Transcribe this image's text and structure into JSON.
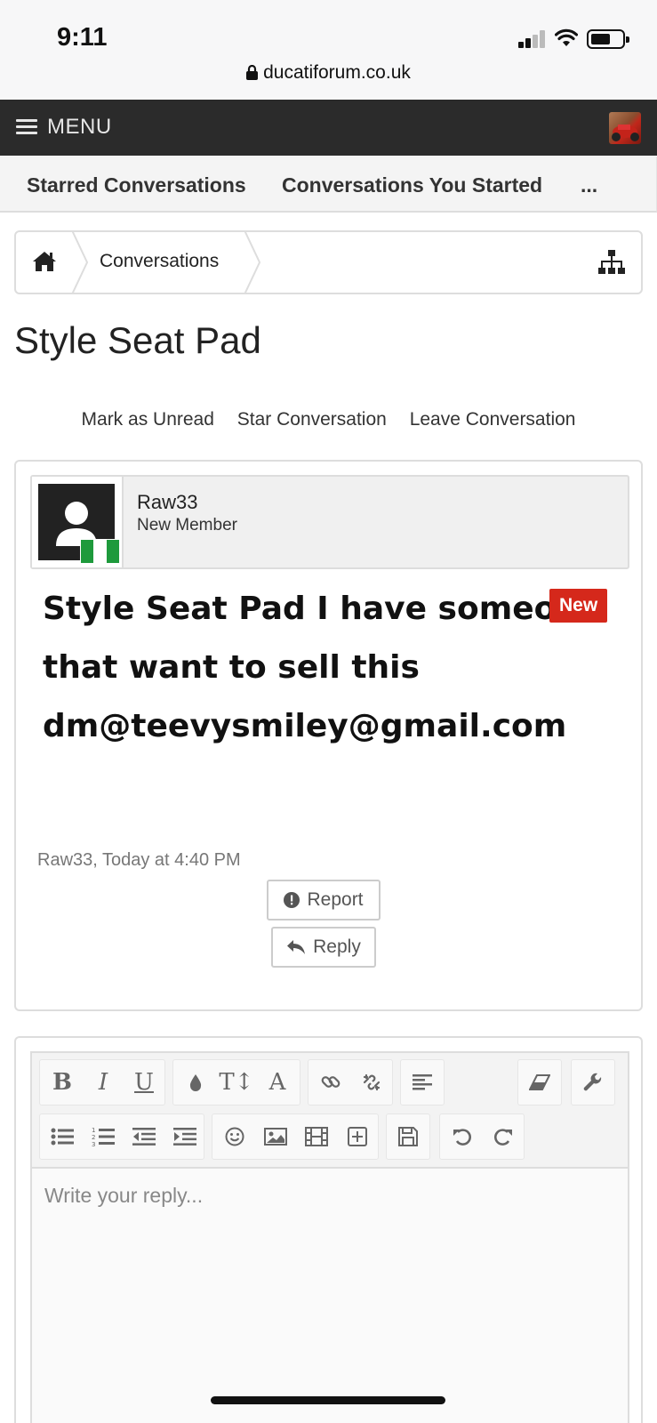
{
  "status_bar": {
    "time": "9:11",
    "url": "ducatiforum.co.uk"
  },
  "menu": {
    "label": "MENU"
  },
  "tabs": [
    "Starred Conversations",
    "Conversations You Started",
    "..."
  ],
  "breadcrumb": {
    "item": "Conversations"
  },
  "page_title": "Style Seat Pad",
  "actions": [
    "Mark as Unread",
    "Star Conversation",
    "Leave Conversation"
  ],
  "message": {
    "username": "Raw33",
    "user_title": "New Member",
    "badge": "New",
    "body": "Style Seat Pad I have someone that want to sell this dm@teevysmiley@gmail.com",
    "meta": "Raw33, Today at 4:40 PM",
    "report_label": "Report",
    "reply_label": "Reply"
  },
  "editor": {
    "placeholder": "Write your reply...",
    "bold_label": "B",
    "italic_label": "I",
    "underline_label": "U",
    "font_size_label": "T↕",
    "font_family_label": "A"
  },
  "colors": {
    "menu_bg": "#2b2b2b",
    "badge": "#d5281b",
    "flag_green": "#1e9a3c"
  }
}
